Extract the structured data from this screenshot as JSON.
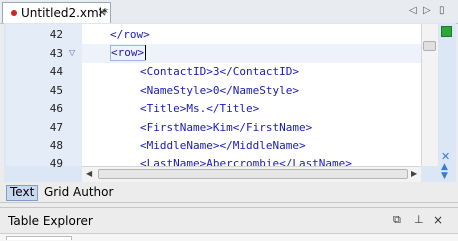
{
  "tab": {
    "title": "Untitled2.xml*",
    "close": "×"
  },
  "nav": {
    "back": "◁",
    "forward": "▷",
    "menu": "▯"
  },
  "editor": {
    "lines": [
      {
        "num": "42",
        "code": "</row>",
        "indent": 1
      },
      {
        "num": "43",
        "code": "<row>",
        "indent": 1,
        "fold": "▽"
      },
      {
        "num": "44",
        "code": "<ContactID>3</ContactID>",
        "indent": 2
      },
      {
        "num": "45",
        "code": "<NameStyle>0</NameStyle>",
        "indent": 2
      },
      {
        "num": "46",
        "code": "<Title>Ms.</Title>",
        "indent": 2
      },
      {
        "num": "47",
        "code": "<FirstName>Kim</FirstName>",
        "indent": 2
      },
      {
        "num": "48",
        "code": "<MiddleName></MiddleName>",
        "indent": 2
      },
      {
        "num": "49",
        "code": "<LastName>Abercrombie</LastName>",
        "indent": 2
      }
    ]
  },
  "modes": {
    "text": "Text",
    "grid": "Grid",
    "author": "Author"
  },
  "table_explorer": {
    "title": "Table Explorer",
    "restore": "⧉",
    "pin": "⊥",
    "close": "×"
  },
  "colors": {
    "tag": "#1a1ab8",
    "status_ok": "#2ea63a",
    "modified_dot": "#d12424"
  }
}
